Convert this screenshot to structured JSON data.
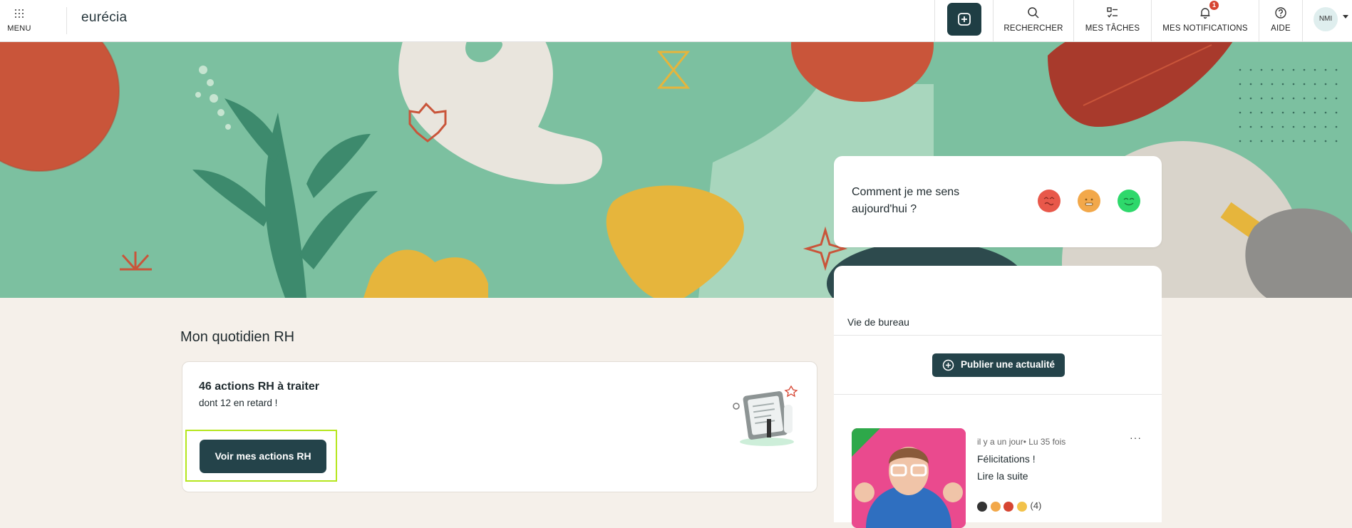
{
  "topbar": {
    "menu_label": "MENU",
    "logo": "eurécia",
    "nav": {
      "search": "RECHERCHER",
      "tasks": "MES TÂCHES",
      "notifications": "MES NOTIFICATIONS",
      "notifications_count": "1",
      "help": "AIDE"
    },
    "user_initials": "NMI",
    "icons": [
      "grid-icon",
      "plus-icon",
      "search-icon",
      "checklist-icon",
      "bell-icon",
      "help-icon",
      "chevron-down-icon"
    ]
  },
  "mood": {
    "question": "Comment je me sens aujourd'hui ?",
    "faces": [
      {
        "name": "sad",
        "color": "#e8584a"
      },
      {
        "name": "neutral",
        "color": "#f2a84a"
      },
      {
        "name": "happy",
        "color": "#2ed86b"
      }
    ]
  },
  "news": {
    "tab": "Vie de bureau",
    "publish_label": "Publier une actualité",
    "post": {
      "meta": "il y a un jour• Lu 35 fois",
      "title": "Félicitations !",
      "read_more": "Lire la suite",
      "reactions_count": "(4)"
    }
  },
  "hr": {
    "section_title": "Mon quotidien RH",
    "count": "46 actions RH à traiter",
    "late": "dont 12 en retard !",
    "button": "Voir mes actions RH"
  },
  "colors": {
    "primary": "#24434a",
    "hero": "#7cc0a0",
    "focus": "#b5e61d",
    "badge": "#d64532",
    "page_bg": "#f5f0ea"
  }
}
